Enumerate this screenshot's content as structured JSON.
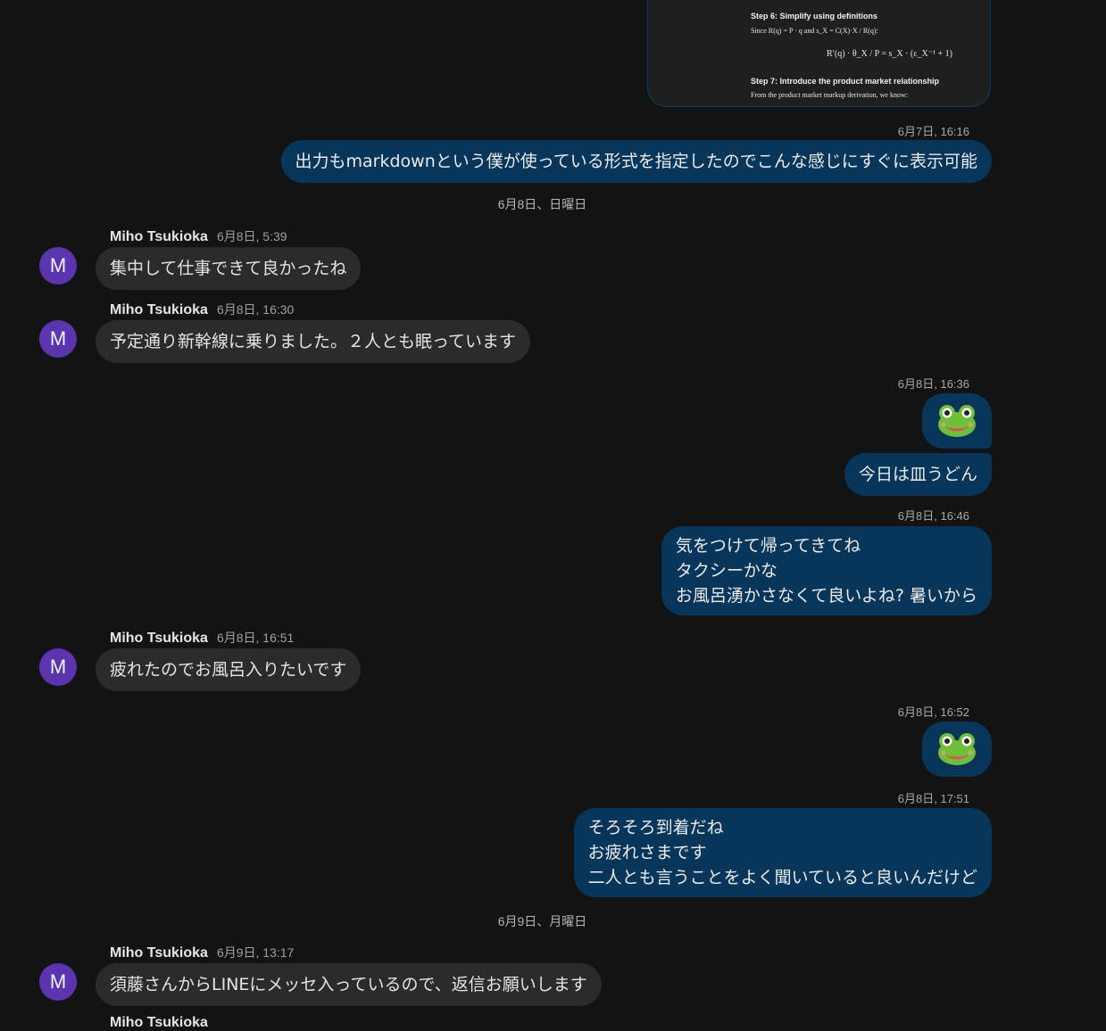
{
  "card": {
    "step6_title": "Step 6: Simplify using definitions",
    "step6_text": "Since R(q) = P · q and s_X = C(X)·X / R(q):",
    "step6_eq": "R′(q) · θ_X / P = s_X · (ε_X⁻¹ + 1)",
    "step7_title": "Step 7: Introduce the product market relationship",
    "step7_text": "From the product market markup derivation, we know:"
  },
  "messages": {
    "m1_time": "6月7日, 16:16",
    "m1_text": "出力もmarkdownという僕が使っている形式を指定したのでこんな感じにすぐに表示可能",
    "day1": "6月8日、日曜日",
    "m2_sender": "Miho Tsukioka",
    "m2_time": "6月8日, 5:39",
    "m2_text": "集中して仕事できて良かったね",
    "m3_sender": "Miho Tsukioka",
    "m3_time": "6月8日, 16:30",
    "m3_text": "予定通り新幹線に乗りました。２人とも眠っています",
    "m4_time": "6月8日, 16:36",
    "m4_emoji": "frog-emoji",
    "m4_text": "今日は皿うどん",
    "m5_time": "6月8日, 16:46",
    "m5_line1": "気をつけて帰ってきてね",
    "m5_line2": "タクシーかな",
    "m5_line3": "お風呂湧かさなくて良いよね? 暑いから",
    "m6_sender": "Miho Tsukioka",
    "m6_time": "6月8日, 16:51",
    "m6_text": "疲れたのでお風呂入りたいです",
    "m7_time": "6月8日, 16:52",
    "m7_emoji": "frog-emoji",
    "m8_time": "6月8日, 17:51",
    "m8_line1": "そろそろ到着だね",
    "m8_line2": "お疲れさまです",
    "m8_line3": "二人とも言うことをよく聞いていると良いんだけど",
    "day2": "6月9日、月曜日",
    "m9_sender": "Miho Tsukioka",
    "m9_time": "6月9日, 13:17",
    "m9_text": "須藤さんからLINEにメッセ入っているので、返信お願いします",
    "m10_sender": "Miho Tsukioka"
  },
  "avatar_letter": "M",
  "colors": {
    "background": "#131314",
    "outgoing": "#07365a",
    "incoming": "#2b2b2c",
    "avatar": "#5b34b0"
  }
}
